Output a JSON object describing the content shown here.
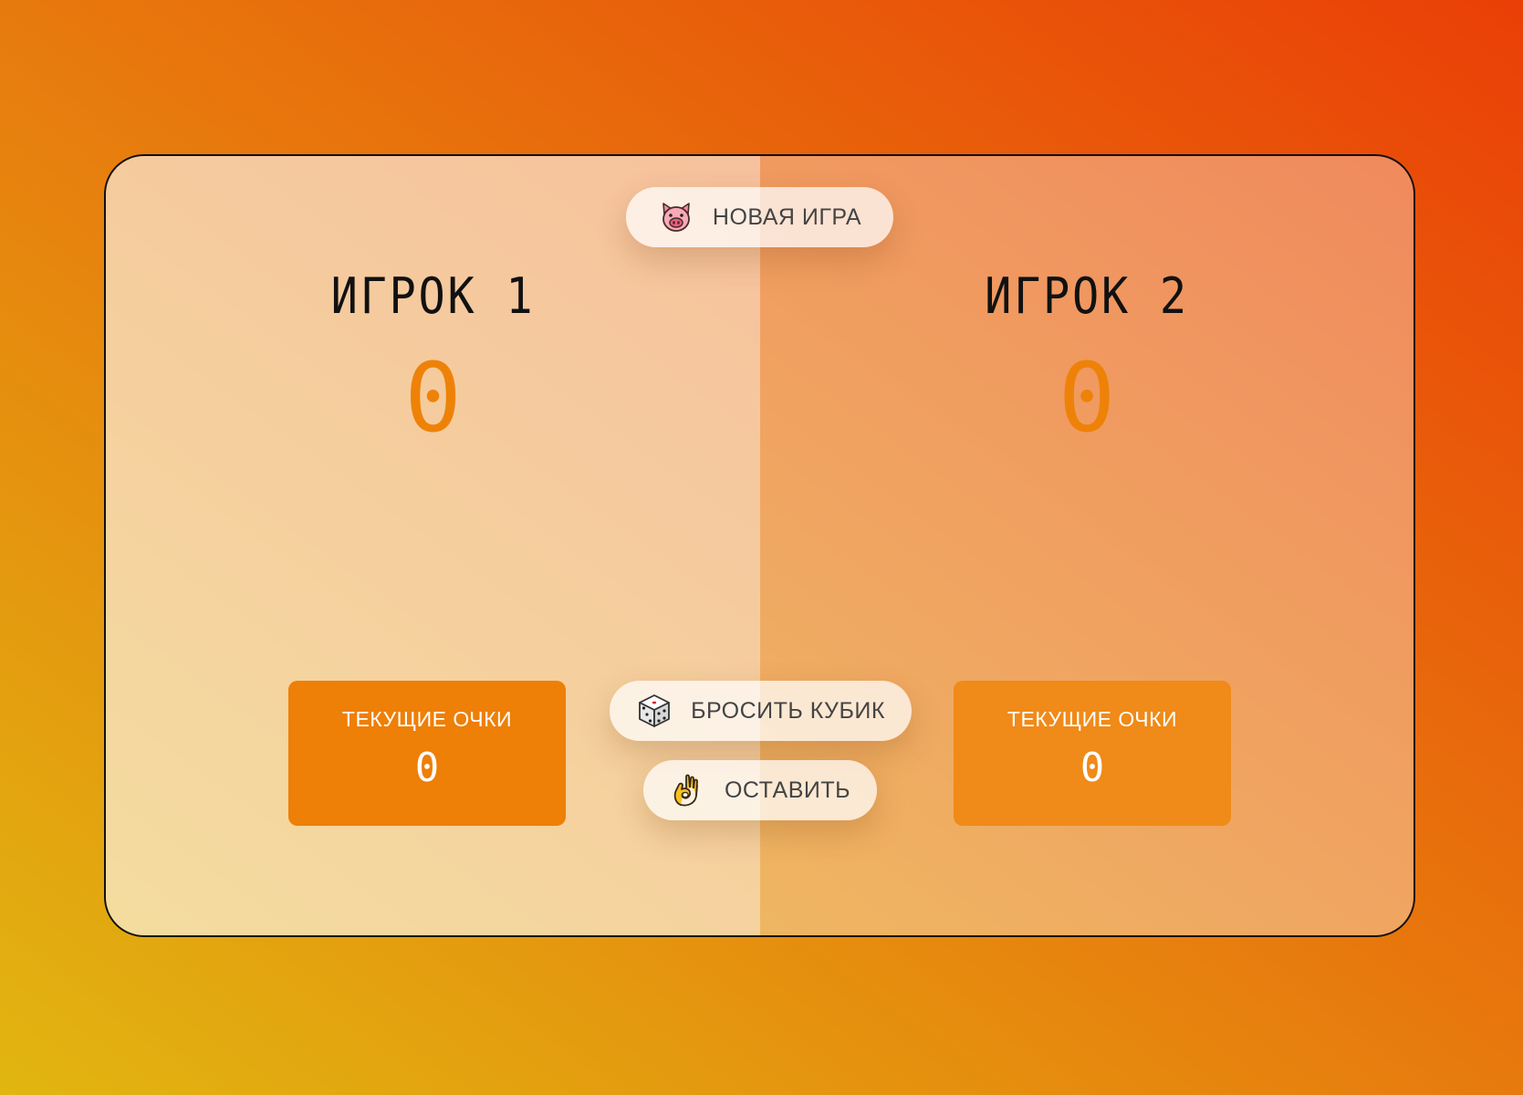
{
  "buttons": {
    "new_game": {
      "label": "НОВАЯ ИГРА",
      "icon": "pig-face-icon"
    },
    "roll_dice": {
      "label": "БРОСИТЬ КУБИК",
      "icon": "dice-icon"
    },
    "hold": {
      "label": "ОСТАВИТЬ",
      "icon": "ok-hand-icon"
    }
  },
  "players": [
    {
      "name": "ИГРОК 1",
      "score": "0",
      "current_label": "ТЕКУЩИЕ ОЧКИ",
      "current_score": "0"
    },
    {
      "name": "ИГРОК 2",
      "score": "0",
      "current_label": "ТЕКУЩИЕ ОЧКИ",
      "current_score": "0"
    }
  ],
  "colors": {
    "accent": "#ee8208",
    "current_box_player_1": "#ee7f07",
    "current_box_player_2": "#f08a18"
  }
}
